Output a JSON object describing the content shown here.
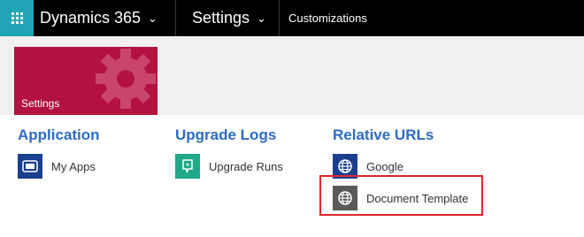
{
  "nav": {
    "app_title": "Dynamics 365",
    "settings_label": "Settings",
    "breadcrumb": "Customizations"
  },
  "tile": {
    "label": "Settings"
  },
  "groups": [
    {
      "title": "Application",
      "items": [
        {
          "label": "My Apps",
          "icon": "my-apps-icon"
        }
      ]
    },
    {
      "title": "Upgrade Logs",
      "items": [
        {
          "label": "Upgrade Runs",
          "icon": "upgrade-runs-icon"
        }
      ]
    },
    {
      "title": "Relative URLs",
      "items": [
        {
          "label": "Google",
          "icon": "globe-icon"
        },
        {
          "label": "Document Template",
          "icon": "globe-icon"
        }
      ]
    }
  ],
  "colors": {
    "waffle": "#1fa5b6",
    "tile": "#b3123f",
    "group_title": "#2e6cc4",
    "highlight": "#e0262c"
  }
}
